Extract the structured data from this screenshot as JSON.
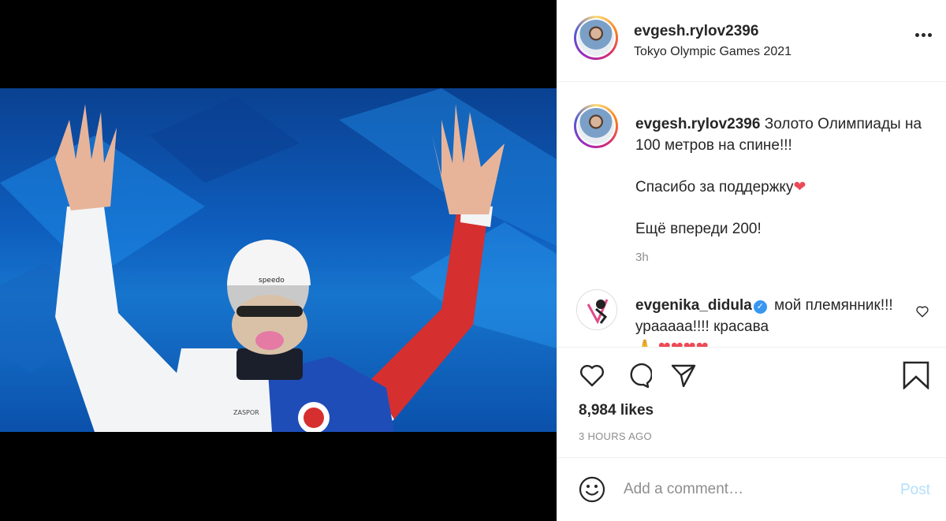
{
  "header": {
    "username": "evgesh.rylov2396",
    "location": "Tokyo Olympic Games 2021"
  },
  "caption": {
    "username": "evgesh.rylov2396",
    "line1": "Золото Олимпиады на 100 метров на спине!!!",
    "line2": "Спасибо за поддержку",
    "line2_emoji": "❤",
    "line3": "Ещё впереди 200!",
    "time": "3h"
  },
  "comments": [
    {
      "username": "evgenika_didula",
      "verified_glyph": "✓",
      "text": "мой племянник!!! урааааа!!!! красава",
      "trailing_emoji": "🙏 ❤❤❤❤"
    }
  ],
  "photo": {
    "cap_brand": "speedo",
    "jacket_text": "ZASPOR"
  },
  "actions": {
    "likes": "8,984 likes",
    "time": "3 HOURS AGO"
  },
  "comment_box": {
    "placeholder": "Add a comment…",
    "post_label": "Post"
  },
  "colors": {
    "link_disabled": "#b2dffc",
    "secondary_text": "#8e8e8e",
    "heart": "#ed4956",
    "verified": "#3897f0"
  },
  "icons": [
    "more-icon",
    "heart-icon",
    "comment-icon",
    "share-icon",
    "bookmark-icon",
    "emoji-icon",
    "verified-icon"
  ]
}
